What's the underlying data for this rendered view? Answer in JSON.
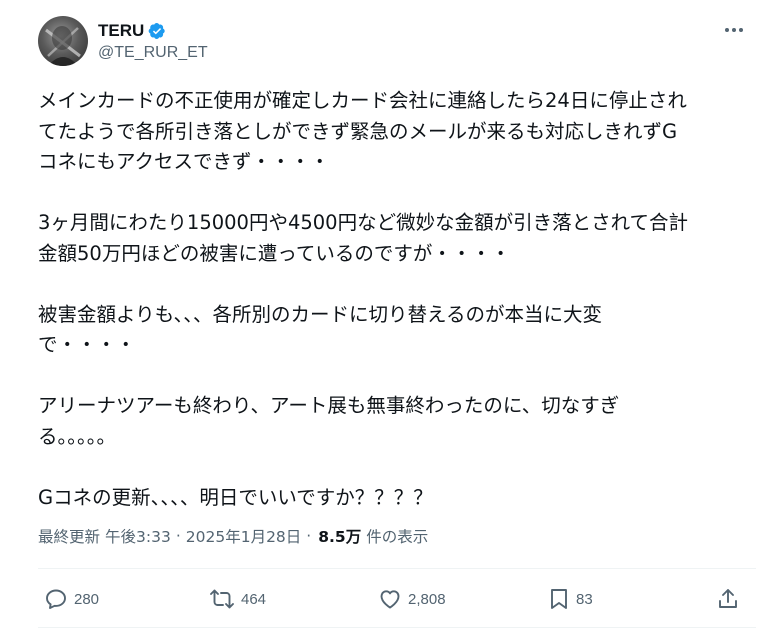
{
  "author": {
    "name": "TERU",
    "handle": "@TE_RUR_ET",
    "avatar_icon": "avatar-photo",
    "verified_icon": "verified-badge-icon",
    "verified_color": "#1d9bf0"
  },
  "post": {
    "paragraphs": [
      "メインカードの不正使用が確定しカード会社に連絡したら24日に停止され\nてたようで各所引き落としができず緊急のメールが来るも対応しきれずG\nコネにもアクセスできず・・・・",
      "3ヶ月間にわたり15000円や4500円など微妙な金額が引き落とされて合計\n金額50万円ほどの被害に遭っているのですが・・・・",
      "被害金額よりも、、、各所別のカードに切り替えるのが本当に大変\nで・・・・",
      "アリーナツアーも終わり、アート展も無事終わったのに、切なすぎ\nる。。。。。",
      "Gコネの更新、、、、明日でいいですか？？？？"
    ]
  },
  "meta": {
    "updated_label": "最終更新",
    "time": "午後3:33",
    "separator": "·",
    "date": "2025年1月28日",
    "views": "8.5万",
    "views_label": "件の表示"
  },
  "actions": {
    "reply_count": "280",
    "repost_count": "464",
    "like_count": "2,808",
    "bookmark_count": "83"
  },
  "colors": {
    "text": "#0f1419",
    "secondary": "#536471",
    "divider": "#eff3f4"
  }
}
